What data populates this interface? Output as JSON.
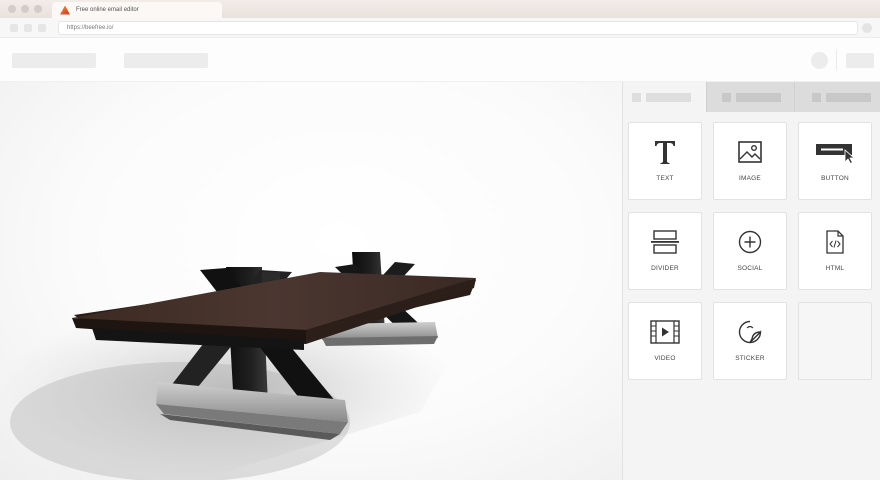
{
  "browser": {
    "tab_title": "Free online email editor",
    "url": "https://beefree.io/"
  },
  "sidebar": {
    "tiles": [
      {
        "label": "TEXT",
        "icon": "text-icon"
      },
      {
        "label": "IMAGE",
        "icon": "image-icon"
      },
      {
        "label": "BUTTON",
        "icon": "button-icon"
      },
      {
        "label": "DIVIDER",
        "icon": "divider-icon"
      },
      {
        "label": "SOCIAL",
        "icon": "social-icon"
      },
      {
        "label": "HTML",
        "icon": "html-icon"
      },
      {
        "label": "VIDEO",
        "icon": "video-icon"
      },
      {
        "label": "STICKER",
        "icon": "sticker-icon"
      }
    ]
  },
  "canvas": {
    "image": "trestle-dining-table-image"
  }
}
